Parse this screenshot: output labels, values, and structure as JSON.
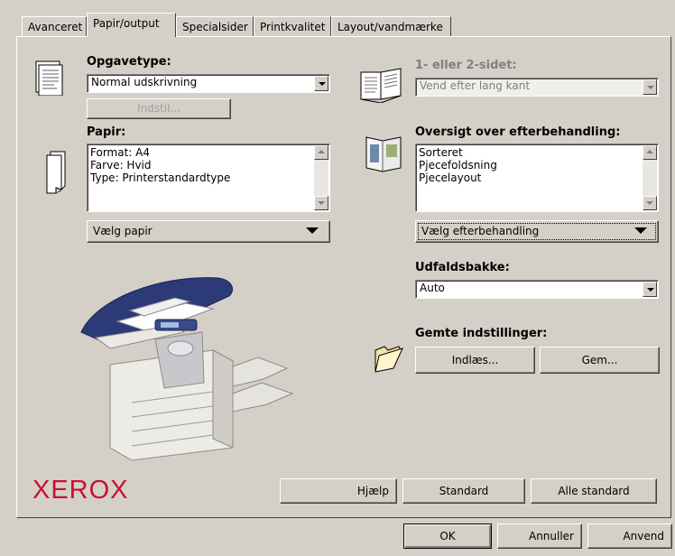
{
  "tabs": [
    {
      "label": "Avanceret"
    },
    {
      "label": "Papir/output"
    },
    {
      "label": "Specialsider"
    },
    {
      "label": "Printkvalitet"
    },
    {
      "label": "Layout/vandmærke"
    }
  ],
  "job_type": {
    "label": "Opgavetype:",
    "value": "Normal udskrivning",
    "setup_button": "Indstil..."
  },
  "paper": {
    "label": "Papir:",
    "lines": [
      "Format: A4",
      "Farve: Hvid",
      "Type: Printerstandardtype"
    ],
    "select_button": "Vælg papir"
  },
  "sides": {
    "label": "1- eller 2-sidet:",
    "value": "Vend efter lang kant"
  },
  "finishing": {
    "label": "Oversigt over efterbehandling:",
    "lines": [
      "Sorteret",
      "Pjecefoldsning",
      "Pjecelayout"
    ],
    "select_button": "Vælg efterbehandling"
  },
  "output_tray": {
    "label": "Udfaldsbakke:",
    "value": "Auto"
  },
  "saved_settings": {
    "label": "Gemte indstillinger:",
    "load_button": "Indlæs...",
    "save_button": "Gem..."
  },
  "brand": {
    "logo_text": "XEROX",
    "color": "#c8102e"
  },
  "footer_buttons": {
    "help": "Hjælp",
    "standard": "Standard",
    "all_standard": "Alle standard"
  },
  "dialog_buttons": {
    "ok": "OK",
    "cancel": "Annuller",
    "apply": "Anvend"
  },
  "icons": [
    "document-icon",
    "paper-stack-icon",
    "duplex-book-icon",
    "booklet-icon",
    "folder-icon",
    "printer-illustration"
  ]
}
